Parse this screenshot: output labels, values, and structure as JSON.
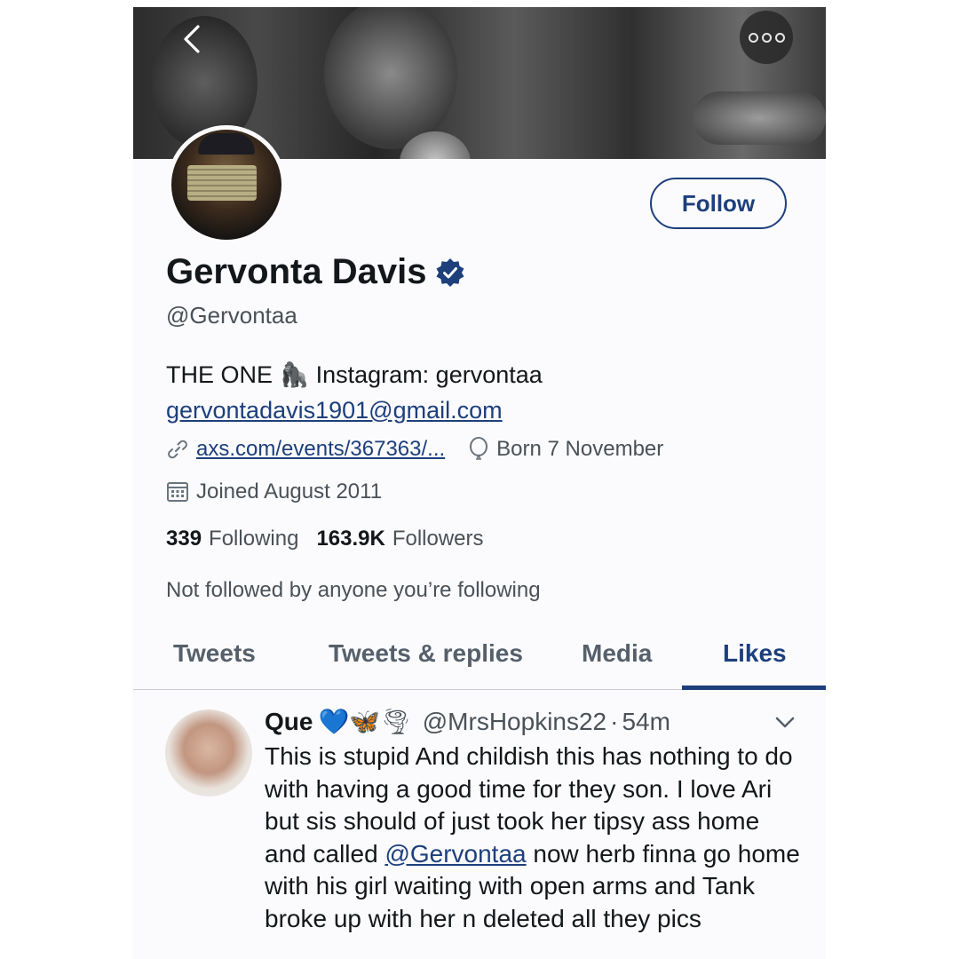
{
  "header": {
    "back_icon": "chevron-left-icon",
    "more_icon": "more-horizontal-icon"
  },
  "profile": {
    "follow_label": "Follow",
    "name": "Gervonta Davis",
    "verified_icon": "verified-badge-icon",
    "handle": "@Gervontaa",
    "bio_line1": "THE ONE 🦍 Instagram: gervontaa",
    "bio_email": "gervontadavis1901@gmail.com",
    "website": "axs.com/events/367363/...",
    "birthday": "Born 7 November",
    "joined": "Joined August 2011",
    "following_count": "339",
    "following_label": "Following",
    "followers_count": "163.9K",
    "followers_label": "Followers",
    "not_followed_text": "Not followed by anyone you’re following"
  },
  "tabs": [
    {
      "label": "Tweets"
    },
    {
      "label": "Tweets & replies"
    },
    {
      "label": "Media"
    },
    {
      "label": "Likes",
      "active": true
    }
  ],
  "tweet": {
    "display_name": "Que",
    "emojis": "💙🦋🌪",
    "handle": "@MrsHopkins22",
    "time": "54m",
    "text_part1": "This is stupid And childish this has nothing to do with having a good time for they son. I love Ari but sis should of just took her tipsy ass home and called ",
    "mention": "@Gervontaa",
    "text_part2": " now herb finna go home with his girl waiting with open arms and Tank broke up with her n deleted all they pics"
  },
  "colors": {
    "accent": "#1d3f7c",
    "text_primary": "#14171a",
    "text_secondary": "#4a5157",
    "background": "#fbfbfd"
  }
}
